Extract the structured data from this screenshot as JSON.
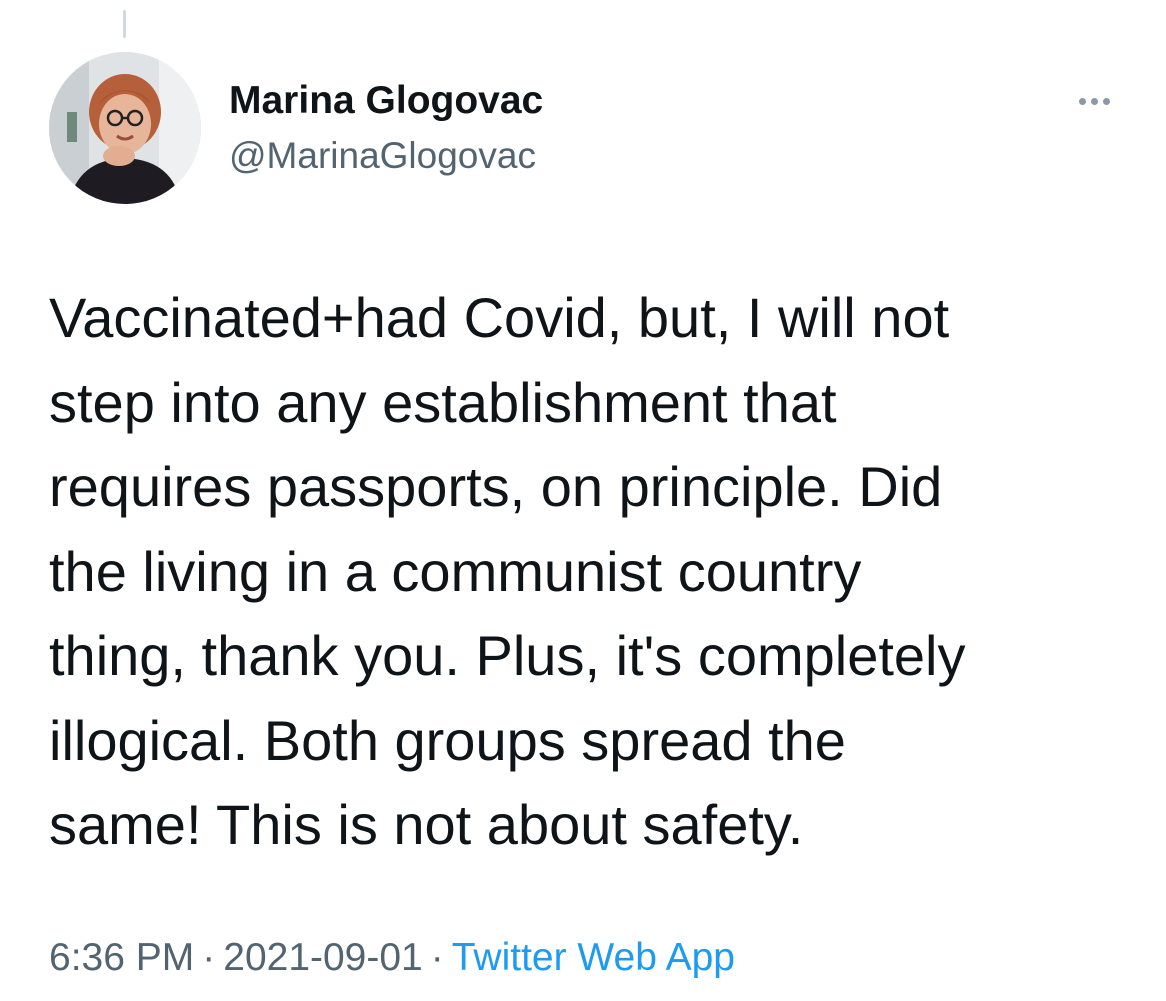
{
  "tweet": {
    "author": {
      "display_name": "Marina Glogovac",
      "handle": "@MarinaGlogovac"
    },
    "text_lines": [
      "Vaccinated+had Covid, but, I will not",
      "step into any establishment that",
      "requires passports, on principle. Did",
      "the living in a communist country",
      "thing, thank you. Plus, it's completely",
      "illogical. Both groups spread the",
      "same! This is not about safety."
    ],
    "time": "6:36 PM",
    "date": "2021-09-01",
    "separator": "·",
    "source": "Twitter Web App"
  },
  "icons": {
    "more": "more-horizontal-icon",
    "avatar": "avatar"
  },
  "colors": {
    "text": "#0f1419",
    "secondary": "#536471",
    "link": "#1d9bf0",
    "thread_line": "#cfd9de"
  }
}
